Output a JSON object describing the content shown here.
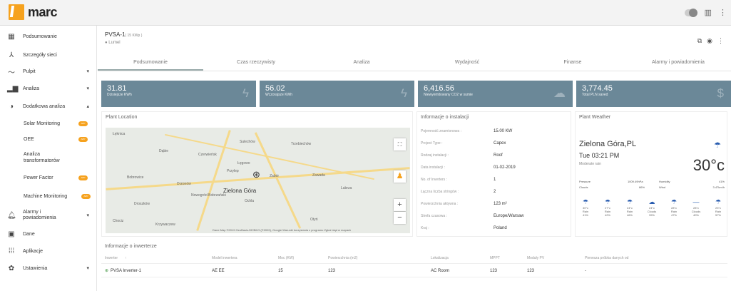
{
  "app": {
    "logo_text": "marc"
  },
  "topbar": {
    "icons": [
      "toggle-icon",
      "panel-icon",
      "more-vertical-icon"
    ]
  },
  "sidebar": {
    "items": [
      {
        "icon": "grid-icon",
        "label": "Podsumowanie"
      },
      {
        "icon": "network-icon",
        "label": "Szczegóły sieci"
      },
      {
        "icon": "trend-icon",
        "label": "Pulpit"
      },
      {
        "icon": "bar-chart-icon",
        "label": "Analiza"
      },
      {
        "icon": "circle-icon",
        "label": "Dodatkowa analiza"
      },
      {
        "icon": "bell-icon",
        "label": "Alarmy i powiadomienia"
      },
      {
        "icon": "data-icon",
        "label": "Dane"
      },
      {
        "icon": "apps-icon",
        "label": "Aplikacje"
      },
      {
        "icon": "gear-icon",
        "label": "Ustawienia"
      }
    ],
    "subitems": [
      {
        "label": "Solar Monitoring",
        "badge": "APP"
      },
      {
        "label": "OEE",
        "badge": "APP"
      },
      {
        "label": "Analiza transformatorów",
        "badge": "APP"
      },
      {
        "label": "Power Factor",
        "badge": "APP"
      },
      {
        "label": "Machine Monitoring",
        "badge": "APP"
      }
    ]
  },
  "header": {
    "title": "PVSA-1",
    "sub": "( 15 KWp )",
    "location": "Lumel"
  },
  "tabs": [
    "Podsumowanie",
    "Czas rzeczywisty",
    "Analiza",
    "Wydajność",
    "Finanse",
    "Alarmy i powiadomienia"
  ],
  "cards": [
    {
      "value": "31.81",
      "label": "Dzisiejsze KWh",
      "icon": "bolt-icon"
    },
    {
      "value": "56.02",
      "label": "Wczorajsze KWh",
      "icon": "bolt-icon"
    },
    {
      "value": "6,416.56",
      "label": "Niewyemitowany CO2 w sumie",
      "icon": "cloud-icon"
    },
    {
      "value": "3,774.45",
      "label": "Total PLN saved",
      "icon": "dollar-icon"
    }
  ],
  "plant_location": {
    "title": "Plant Location",
    "city": "Zielona Góra",
    "attribution": "Dane Map ©2019 GeoBasis-DE/BKG (©2009), Google  Warunki korzystania z programu  Zgłoś błąd w mapach",
    "labels": [
      "Czerwieńsk",
      "Sulechów",
      "Trzebiechów",
      "Dąbie",
      "Łęgowo",
      "Przylep",
      "Zawada",
      "Bobrowice",
      "Ochla",
      "Drzonów",
      "Zabór",
      "Nowogród Bobrzański",
      "Lubrza",
      "Droszków",
      "Otyń",
      "Chociz",
      "Krzywaczew",
      "Łęknica"
    ]
  },
  "installation": {
    "title": "Informacje o instalacji",
    "rows": [
      {
        "k": "Pojemność znamionowa :",
        "v": "15.00 KW"
      },
      {
        "k": "Project Type :",
        "v": "Capex"
      },
      {
        "k": "Rodzaj instalacji :",
        "v": "Roof"
      },
      {
        "k": "Data instalacji :",
        "v": "01-02-2019"
      },
      {
        "k": "No. of Inverters :",
        "v": "1"
      },
      {
        "k": "Łączna liczba stringów :",
        "v": "2"
      },
      {
        "k": "Powierzchnia aktywna :",
        "v": "123 m²"
      },
      {
        "k": "Strefa czasowa :",
        "v": "Europe/Warsaw"
      },
      {
        "k": "Kraj :",
        "v": "Poland"
      }
    ]
  },
  "weather": {
    "title": "Plant Weather",
    "city": "Zielona Góra,PL",
    "date": "Tue 03:21 PM",
    "desc": "Moderate rain",
    "temp": "30°c",
    "stats": [
      {
        "k": "Pressure",
        "v": "1009.49hPa"
      },
      {
        "k": "Humidity",
        "v": "41%"
      },
      {
        "k": "Clouds",
        "v": "86%"
      },
      {
        "k": "Wind",
        "v": "3.47km/h"
      }
    ],
    "forecast": [
      {
        "t": "30°c",
        "d": "Rain",
        "p": "41%"
      },
      {
        "t": "27°c",
        "d": "Rain",
        "p": "42%"
      },
      {
        "t": "24°c",
        "d": "Rain",
        "p": "46%"
      },
      {
        "t": "24°c",
        "d": "Clouds",
        "p": "39%"
      },
      {
        "t": "28°c",
        "d": "Rain",
        "p": "47%"
      },
      {
        "t": "28°c",
        "d": "Clouds",
        "p": "40%"
      },
      {
        "t": "23°c",
        "d": "Rain",
        "p": "57%"
      }
    ]
  },
  "inverter": {
    "title": "Informacje o inwerterze",
    "columns": [
      "Inwerter",
      "Model inwertera",
      "Moc (KW)",
      "Powierzchnia (m2)",
      "Lokalizacja",
      "MPPT",
      "Moduły PV",
      "Pierwsza próbka danych od"
    ],
    "rows": [
      [
        "PVSA Inverter-1",
        "AE EE",
        "15",
        "123",
        "AC Room",
        "123",
        "123",
        "-"
      ]
    ]
  },
  "colors": {
    "accent": "#f6a21e",
    "card": "#6b8898",
    "weather_icon": "#2a5db0"
  }
}
